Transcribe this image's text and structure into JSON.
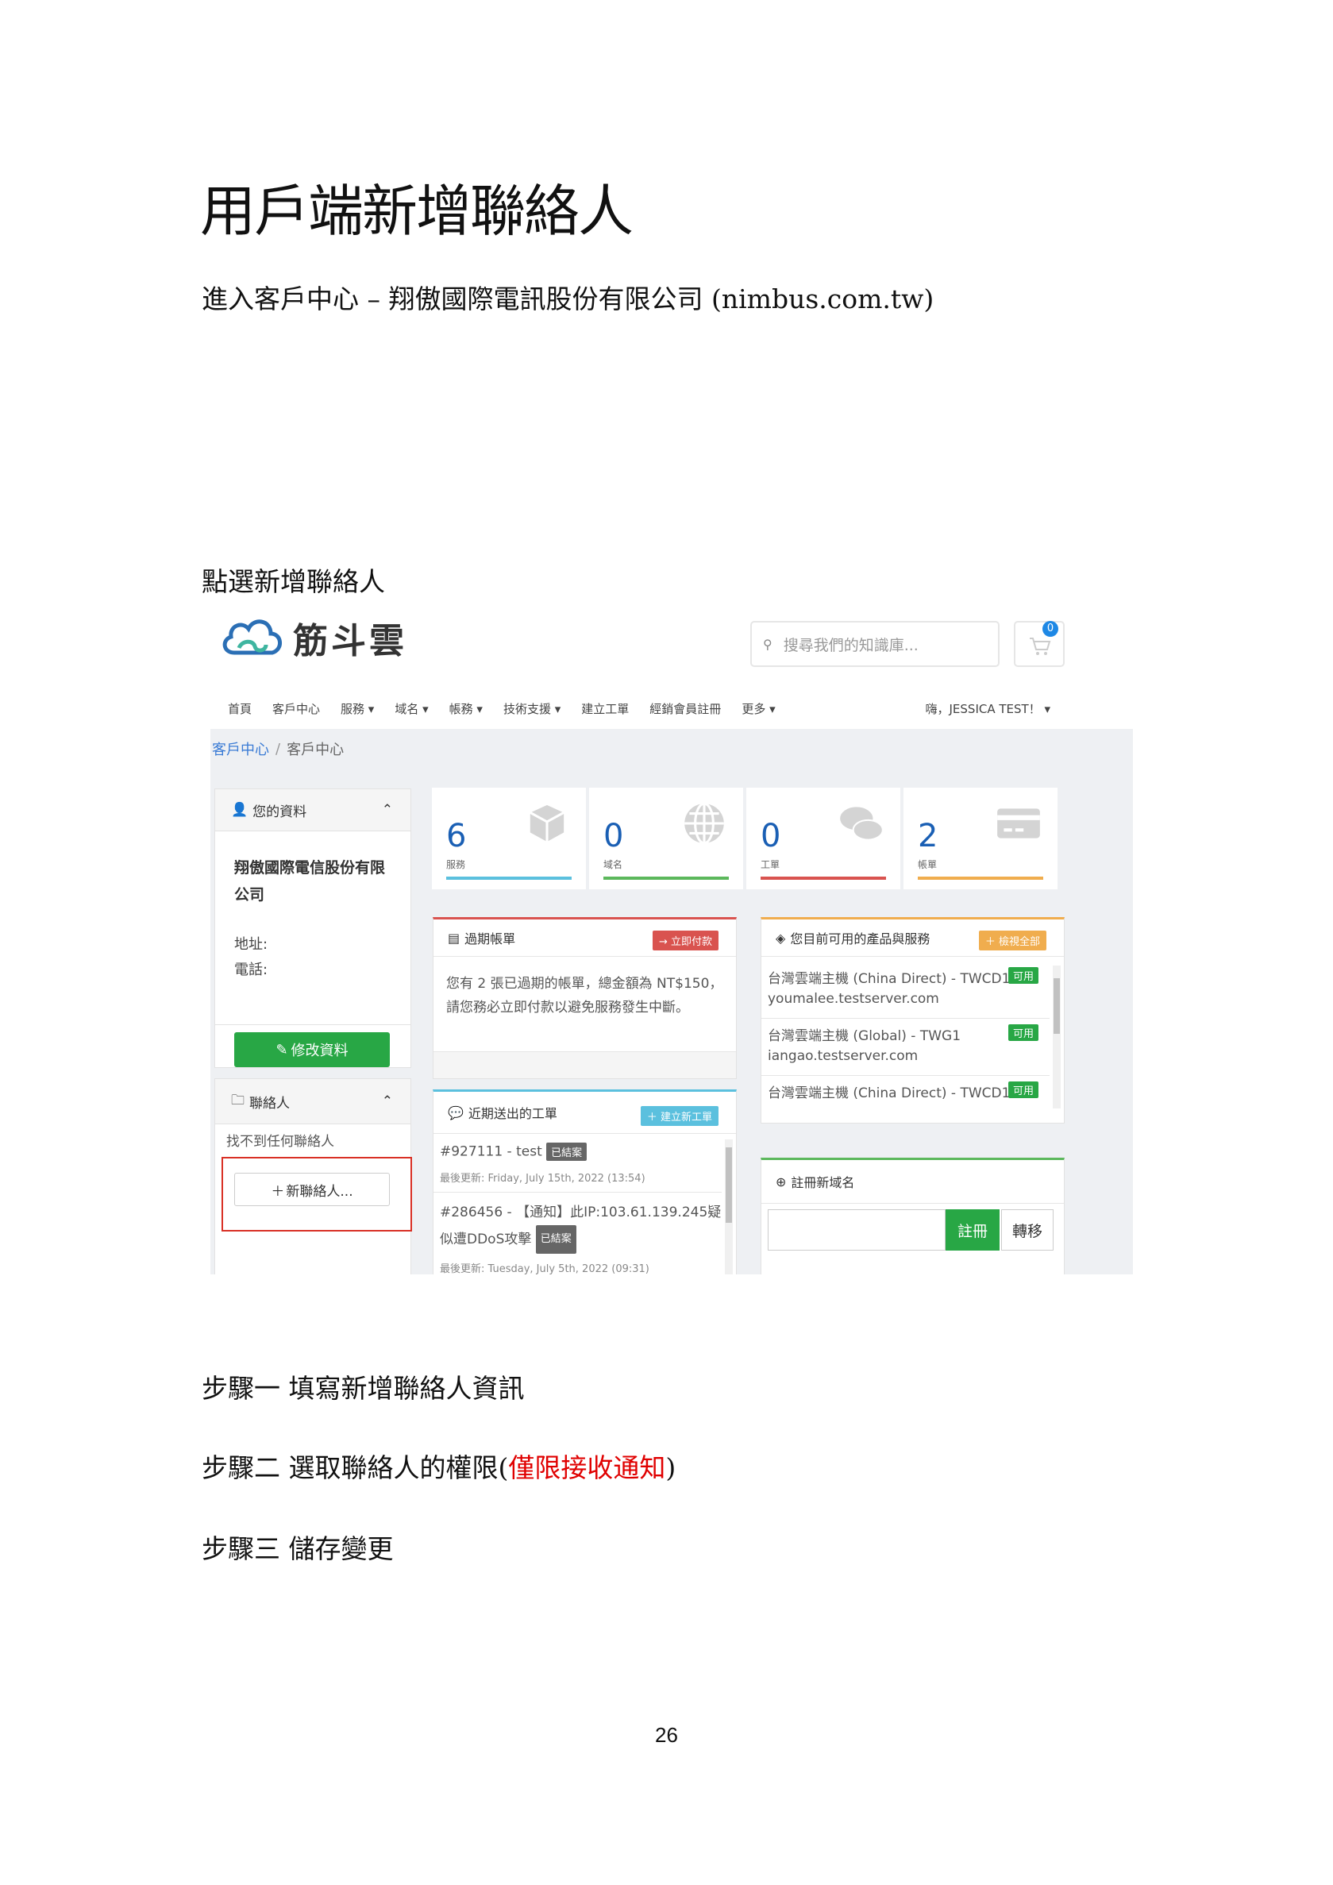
{
  "doc": {
    "title": "用戶端新增聯絡人",
    "intro_prefix": "進入客戶中心  –  翔傲國際電訊股份有限公司",
    "intro_link": "(nimbus.com.tw)",
    "instruction": "點選新增聯絡人",
    "step1": "步驟一  填寫新增聯絡人資訊",
    "step2_prefix": "步驟二  選取聯絡人的權限(",
    "step2_highlight": "僅限接收通知",
    "step2_suffix": ")",
    "step3": "步驟三  儲存變更",
    "page_number": "26"
  },
  "screenshot": {
    "brand": "筋斗雲",
    "search_placeholder": "搜尋我們的知識庫...",
    "cart_count": "0",
    "nav": [
      "首頁",
      "客戶中心",
      "服務 ▾",
      "域名 ▾",
      "帳務 ▾",
      "技術支援 ▾",
      "建立工單",
      "經銷會員註冊",
      "更多 ▾"
    ],
    "user_menu": "嗨，JESSICA TEST！ ▾",
    "breadcrumb": {
      "link": "客戶中心",
      "sep": "/",
      "current": "客戶中心"
    },
    "profile": {
      "header": "您的資料",
      "company_line1": "翔傲國際電信股份有限",
      "company_line2": "公司",
      "address_label": "地址:",
      "phone_label": "電話:",
      "edit_button": "修改資料"
    },
    "contacts": {
      "header": "聯絡人",
      "empty_text": "找不到任何聯絡人",
      "new_button": "新聯絡人..."
    },
    "stats": [
      {
        "num": "6",
        "label": "服務",
        "icon": "cube-icon",
        "color": "#5bc0de"
      },
      {
        "num": "0",
        "label": "域名",
        "icon": "globe-icon",
        "color": "#5cb85c"
      },
      {
        "num": "0",
        "label": "工單",
        "icon": "comments-icon",
        "color": "#d9534f"
      },
      {
        "num": "2",
        "label": "帳單",
        "icon": "credit-card-icon",
        "color": "#f0ad4e"
      }
    ],
    "overdue": {
      "header": "過期帳單",
      "button": "立即付款",
      "text_line1": "您有 2 張已過期的帳單，總金額為 NT$150，",
      "text_line2": "請您務必立即付款以避免服務發生中斷。"
    },
    "products": {
      "header": "您目前可用的產品與服務",
      "button": "檢視全部",
      "items": [
        {
          "name": "台灣雲端主機 (China Direct) - TWCD1",
          "host": "youmalee.testserver.com",
          "status": "可用"
        },
        {
          "name": "台灣雲端主機 (Global) - TWG1",
          "host": "iangao.testserver.com",
          "status": "可用"
        },
        {
          "name": "台灣雲端主機 (China Direct) - TWCD1",
          "host": "",
          "status": "可用"
        }
      ]
    },
    "tickets": {
      "header": "近期送出的工單",
      "button": "建立新工單",
      "items": [
        {
          "title": "#927111 - test",
          "status": "已結案",
          "updated": "最後更新: Friday, July 15th, 2022 (13:54)"
        },
        {
          "title": "#286456 - 【通知】此IP:103.61.139.245疑",
          "title2": "似遭DDoS攻擊",
          "status": "已結案",
          "updated": "最後更新: Tuesday, July 5th, 2022 (09:31)"
        }
      ]
    },
    "domain": {
      "header": "註冊新域名",
      "register_button": "註冊",
      "transfer_button": "轉移"
    }
  }
}
